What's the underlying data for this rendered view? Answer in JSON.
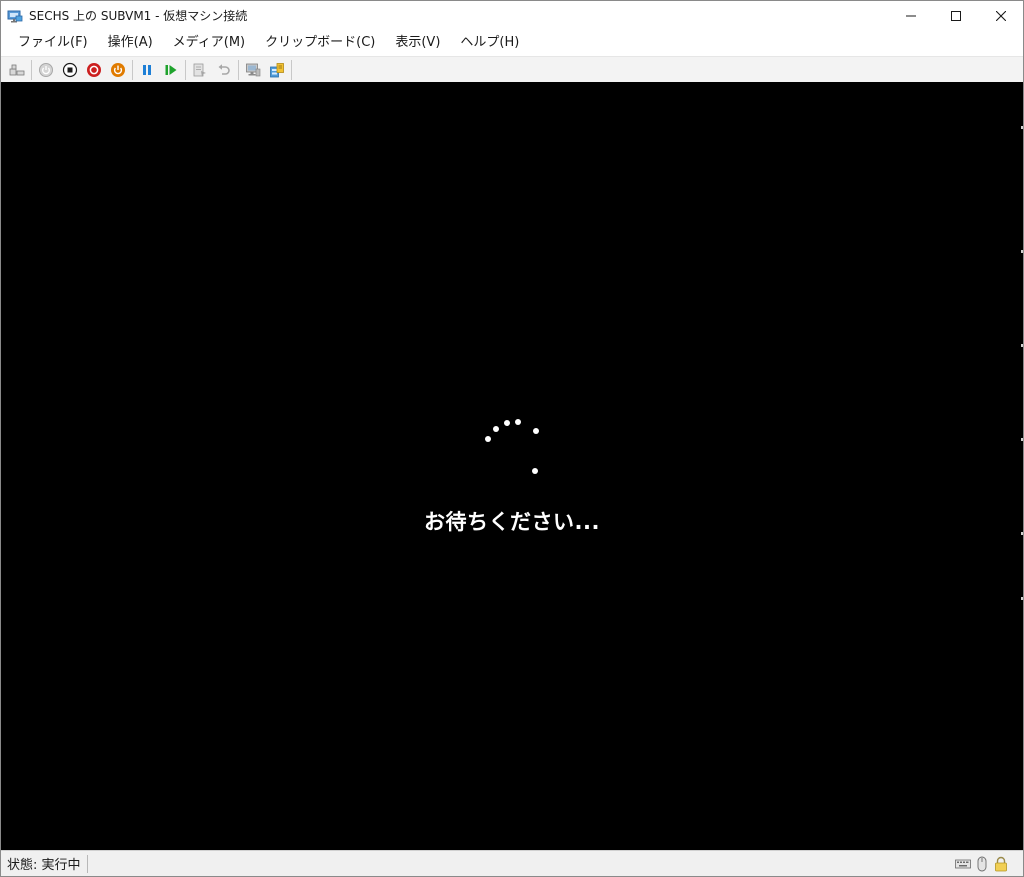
{
  "window": {
    "title": "SECHS 上の SUBVM1 - 仮想マシン接続",
    "controls": [
      "minimize-icon",
      "maximize-icon",
      "close-icon"
    ]
  },
  "menu": {
    "items": [
      {
        "label": "ファイル(F)"
      },
      {
        "label": "操作(A)"
      },
      {
        "label": "メディア(M)"
      },
      {
        "label": "クリップボード(C)"
      },
      {
        "label": "表示(V)"
      },
      {
        "label": "ヘルプ(H)"
      }
    ]
  },
  "toolbar": {
    "buttons": [
      {
        "icon": "ctrl-alt-del-icon",
        "enabled": true
      },
      {
        "icon": "start-icon",
        "enabled": false
      },
      {
        "icon": "turn-off-icon",
        "enabled": true,
        "color": "#1a1a1a"
      },
      {
        "icon": "shutdown-icon",
        "enabled": true,
        "color": "#cc1f1f"
      },
      {
        "icon": "save-icon",
        "enabled": true,
        "color": "#e07b00"
      },
      {
        "icon": "pause-icon",
        "enabled": true,
        "color": "#1e7fd6"
      },
      {
        "icon": "reset-icon",
        "enabled": true,
        "color": "#1fa32d"
      },
      {
        "icon": "checkpoint-icon",
        "enabled": false
      },
      {
        "icon": "revert-icon",
        "enabled": false
      },
      {
        "icon": "enhanced-session-icon",
        "enabled": true
      },
      {
        "icon": "share-icon",
        "enabled": true
      }
    ]
  },
  "screen": {
    "message": "お待ちください...",
    "background": "#000000",
    "text_color": "#ffffff"
  },
  "status": {
    "text": "状態: 実行中",
    "icons": [
      "keyboard-icon",
      "mouse-icon",
      "lock-icon"
    ]
  }
}
